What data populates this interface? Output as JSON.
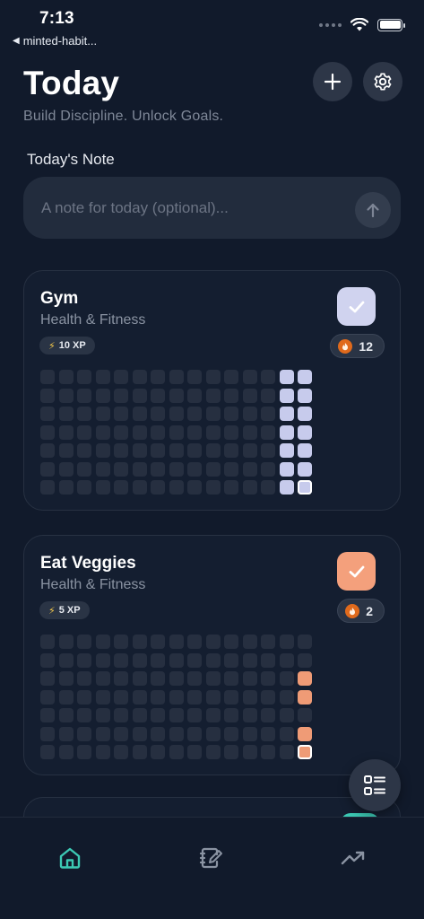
{
  "status_bar": {
    "time": "7:13",
    "back_label": "minted-habit..."
  },
  "header": {
    "title": "Today",
    "subtitle": "Build Discipline. Unlock Goals.",
    "add_icon": "plus-icon",
    "settings_icon": "gear-icon"
  },
  "note": {
    "label": "Today's Note",
    "placeholder": "A note for today (optional)...",
    "value": "",
    "send_icon": "arrow-up-icon"
  },
  "habits": [
    {
      "name": "Gym",
      "category": "Health & Fitness",
      "xp": "10 XP",
      "streak": "12",
      "completed_today": true,
      "accent": "#c7cbec",
      "check_color": "#d0d3ef",
      "cells_filled": [
        [
          13,
          0
        ],
        [
          14,
          0
        ],
        [
          14,
          1
        ],
        [
          13,
          1
        ],
        [
          13,
          2
        ],
        [
          14,
          2
        ],
        [
          13,
          3
        ],
        [
          14,
          3
        ],
        [
          13,
          4
        ],
        [
          14,
          4
        ],
        [
          13,
          5
        ],
        [
          14,
          5
        ],
        [
          13,
          6
        ],
        [
          14,
          6
        ]
      ],
      "cells_filled_note": "pairs are [week-column, weekday-row]"
    },
    {
      "name": "Eat Veggies",
      "category": "Health & Fitness",
      "xp": "5 XP",
      "streak": "2",
      "completed_today": true,
      "accent": "#ef9b76",
      "check_color": "#f4a07c",
      "cells_filled": [
        [
          14,
          2
        ],
        [
          14,
          3
        ],
        [
          14,
          5
        ],
        [
          14,
          6
        ]
      ]
    }
  ],
  "fab_icon": "list-view-icon",
  "tabs": [
    {
      "name": "home",
      "icon": "home-icon",
      "active": true
    },
    {
      "name": "journal",
      "icon": "journal-edit-icon",
      "active": false
    },
    {
      "name": "stats",
      "icon": "trending-up-icon",
      "active": false
    }
  ],
  "colors": {
    "background": "#111a2b",
    "card": "#141e30",
    "empty_cell": "#262f40",
    "active_tab": "#3cc9b4",
    "inactive_tab": "#8a93a2"
  }
}
